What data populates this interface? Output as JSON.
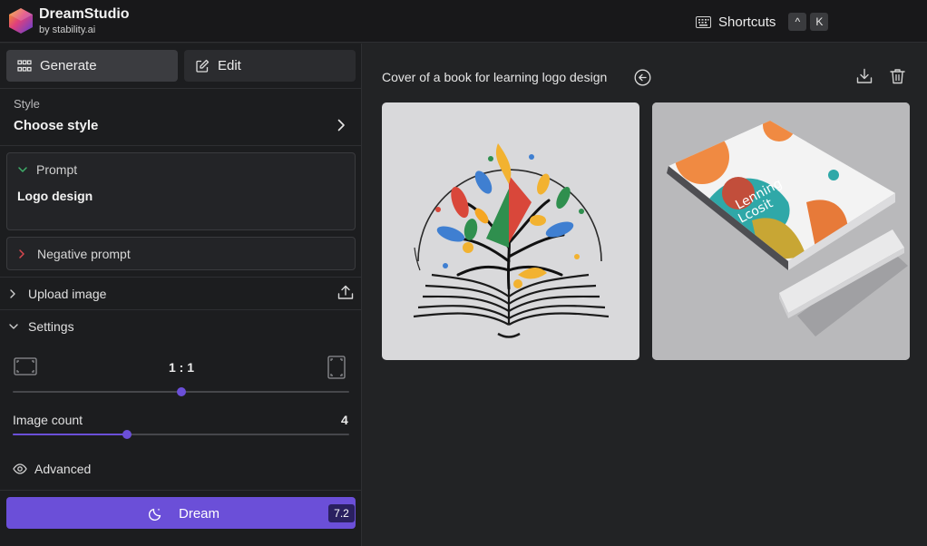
{
  "brand": {
    "name": "DreamStudio",
    "sub": "by stability.ai"
  },
  "header": {
    "shortcuts_label": "Shortcuts",
    "keys": [
      "^",
      "K"
    ]
  },
  "tabs": {
    "generate": "Generate",
    "edit": "Edit"
  },
  "style": {
    "label": "Style",
    "value": "Choose style"
  },
  "prompt": {
    "label": "Prompt",
    "text": "Logo design"
  },
  "negative_prompt": {
    "label": "Negative prompt"
  },
  "upload": {
    "label": "Upload image"
  },
  "settings": {
    "label": "Settings",
    "aspect_ratio": "1 : 1",
    "aspect_slider_fraction": 0.5,
    "image_count_label": "Image count",
    "image_count_value": "4",
    "image_count_fraction": 0.34,
    "advanced_label": "Advanced"
  },
  "dream": {
    "label": "Dream",
    "cost": "7.2"
  },
  "main": {
    "title": "Cover of a book for learning logo design",
    "images": [
      {
        "description": "tree-book-logo-illustration"
      },
      {
        "description": "book-cover-mockup"
      }
    ]
  },
  "colors": {
    "accent": "#6b4fd8",
    "background": "#222325",
    "panel": "#1c1d1f"
  }
}
